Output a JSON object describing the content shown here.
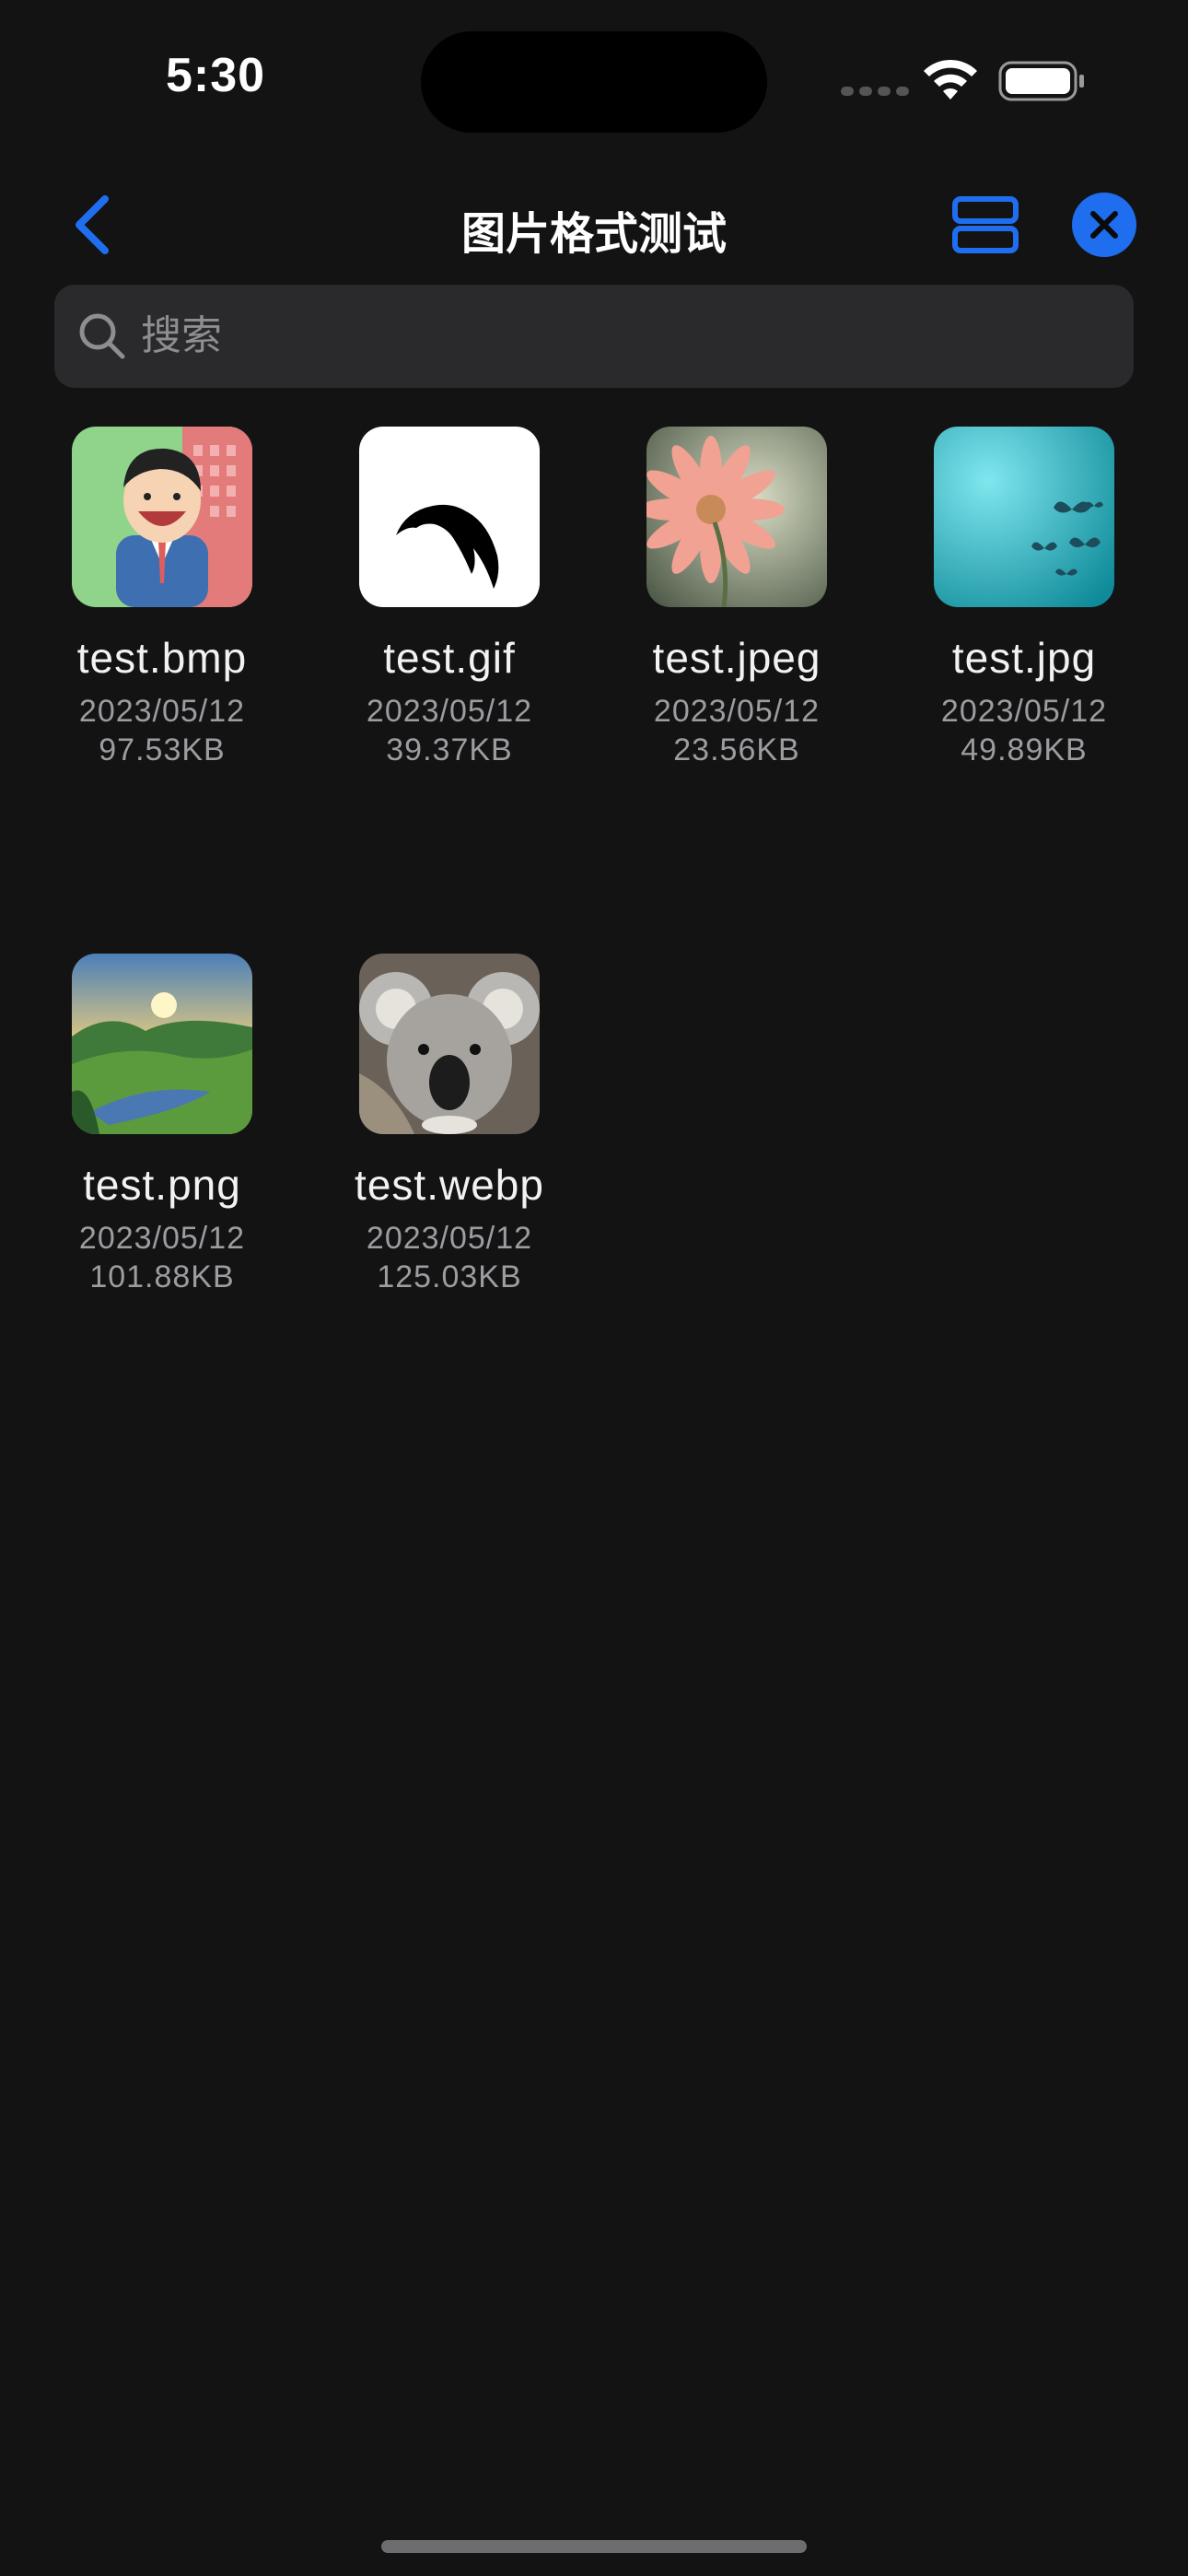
{
  "status_bar": {
    "time": "5:30",
    "icons": [
      "signal-icon",
      "wifi-icon",
      "battery-icon"
    ]
  },
  "nav": {
    "title": "图片格式测试",
    "back_icon": "chevron-left-icon",
    "view_toggle_icon": "list-view-icon",
    "close_icon": "close-icon"
  },
  "search": {
    "placeholder": "搜索",
    "value": ""
  },
  "colors": {
    "accent": "#1f6ef0",
    "background": "#131313",
    "search_bg": "#2a2a2c",
    "secondary_text": "#9c9ca1"
  },
  "files": [
    {
      "name": "test.bmp",
      "date": "2023/05/12",
      "size": "97.53KB",
      "thumbnail": "cartoon-man-thumbnail"
    },
    {
      "name": "test.gif",
      "date": "2023/05/12",
      "size": "39.37KB",
      "thumbnail": "black-bird-thumbnail"
    },
    {
      "name": "test.jpeg",
      "date": "2023/05/12",
      "size": "23.56KB",
      "thumbnail": "pink-flower-thumbnail"
    },
    {
      "name": "test.jpg",
      "date": "2023/05/12",
      "size": "49.89KB",
      "thumbnail": "butterflies-teal-thumbnail"
    },
    {
      "name": "test.png",
      "date": "2023/05/12",
      "size": "101.88KB",
      "thumbnail": "landscape-thumbnail"
    },
    {
      "name": "test.webp",
      "date": "2023/05/12",
      "size": "125.03KB",
      "thumbnail": "koala-thumbnail"
    }
  ]
}
